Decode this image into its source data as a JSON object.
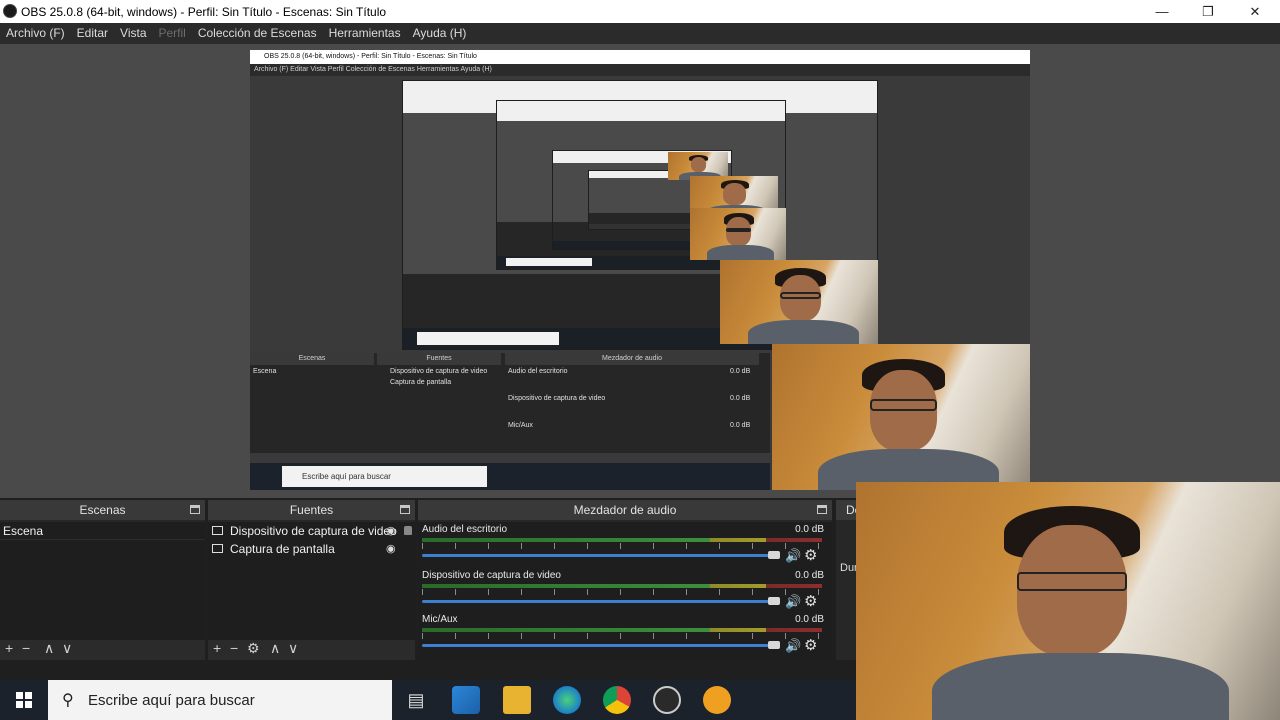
{
  "window": {
    "title": "OBS 25.0.8 (64-bit, windows) - Perfil: Sin Título - Escenas: Sin Título",
    "minimize_icon": "minimize-icon",
    "maximize_icon": "restore-icon",
    "close_icon": "close-icon"
  },
  "menu": {
    "items": [
      "Archivo (F)",
      "Editar",
      "Vista",
      "Perfil",
      "Colección de Escenas",
      "Herramientas",
      "Ayuda (H)"
    ]
  },
  "preview": {
    "nested_title": "OBS 25.0.8 (64-bit, windows) - Perfil: Sin Título - Escenas: Sin Título",
    "nested_menu": "Archivo (F)   Editar   Vista   Perfil   Colección de Escenas   Herramientas   Ayuda (H)",
    "nested_scenes": "Escenas",
    "nested_sources": "Fuentes",
    "nested_mixer": "Mezdador de audio",
    "nested_scene_item": "Escena",
    "nested_src1": "Dispositivo de captura de video",
    "nested_src2": "Captura de pantalla",
    "nested_ch1": "Audio del escritorio",
    "nested_ch2": "Dispositivo de captura de video",
    "nested_ch3": "Mic/Aux",
    "nested_db": "0.0 dB",
    "nested_search": "Escribe aquí para buscar"
  },
  "scenes_panel": {
    "title": "Escenas",
    "items": [
      "Escena"
    ],
    "footer": [
      "+",
      "−",
      "∧",
      "∨"
    ]
  },
  "sources_panel": {
    "title": "Fuentes",
    "items": [
      {
        "label": "Dispositivo de captura de video",
        "icon": "camera-icon"
      },
      {
        "label": "Captura de pantalla",
        "icon": "monitor-icon"
      }
    ],
    "footer": [
      "+",
      "−",
      "⚙",
      "∧",
      "∨"
    ]
  },
  "mixer_panel": {
    "title": "Mezdador de audio",
    "channels": [
      {
        "name": "Audio del escritorio",
        "db": "0.0 dB"
      },
      {
        "name": "Dispositivo de captura de video",
        "db": "0.0 dB"
      },
      {
        "name": "Mic/Aux",
        "db": "0.0 dB"
      }
    ]
  },
  "cut_panel": {
    "title_fragment": "De",
    "duration_fragment": "Dur"
  },
  "taskbar": {
    "search_placeholder": "Escribe aquí para buscar",
    "icons": [
      "task-view-icon",
      "vscode-icon",
      "file-explorer-icon",
      "edge-beta-icon",
      "chrome-icon",
      "obs-icon",
      "app-orange-icon"
    ]
  },
  "colors": {
    "bg": "#2b2b2b",
    "panel": "#272727",
    "accent_slider": "#3f7fd0",
    "taskbar": "#1c222b"
  }
}
